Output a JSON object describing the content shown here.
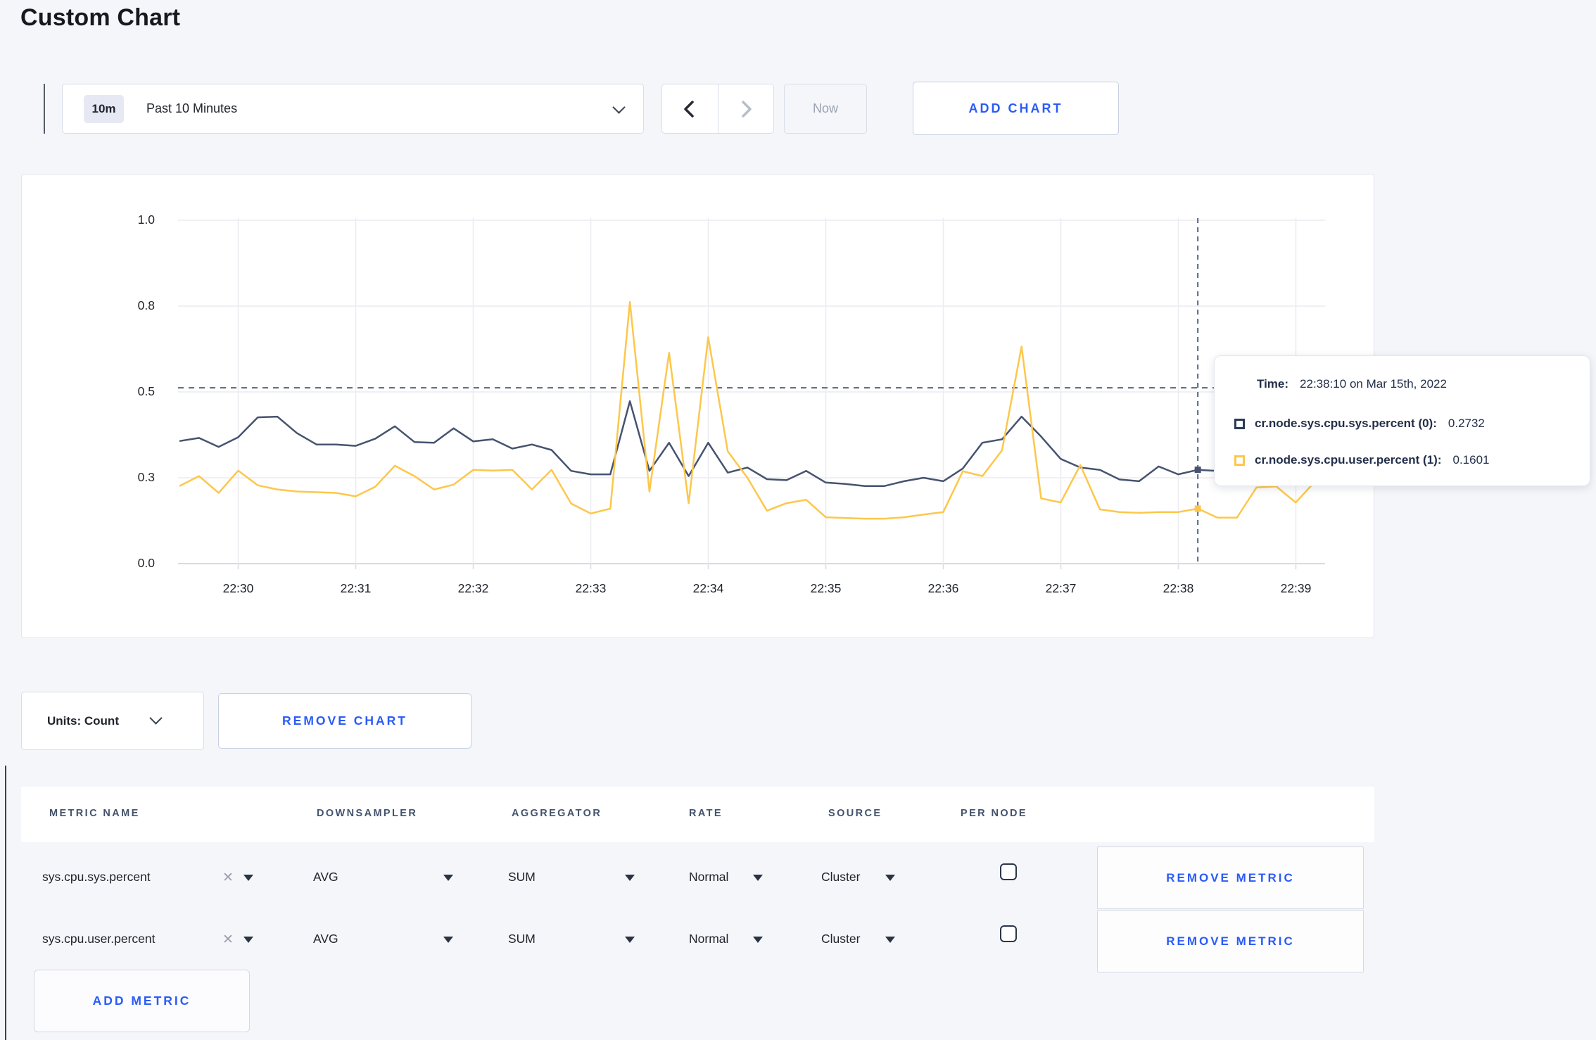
{
  "page": {
    "title": "Custom Chart",
    "accent_color": "#2a5bf7",
    "background": "#f5f6fa"
  },
  "toolbar": {
    "range_badge": "10m",
    "range_label": "Past 10 Minutes",
    "prev_icon": "chevron-left",
    "next_icon": "chevron-right",
    "now_label": "Now",
    "add_chart_label": "ADD CHART"
  },
  "chart_controls": {
    "units_label": "Units: Count",
    "remove_chart_label": "REMOVE CHART"
  },
  "tooltip": {
    "time_label": "Time:",
    "time_value": "22:38:10 on Mar 15th, 2022",
    "entries": [
      {
        "label": "cr.node.sys.cpu.sys.percent (0):",
        "value": "0.2732",
        "color": "#2c3a54"
      },
      {
        "label": "cr.node.sys.cpu.user.percent (1):",
        "value": "0.1601",
        "color": "#fdc74b"
      }
    ]
  },
  "table": {
    "columns": [
      "METRIC NAME",
      "DOWNSAMPLER",
      "AGGREGATOR",
      "RATE",
      "SOURCE",
      "PER NODE"
    ],
    "rows": [
      {
        "metric": "sys.cpu.sys.percent",
        "downsampler": "AVG",
        "aggregator": "SUM",
        "rate": "Normal",
        "source": "Cluster",
        "per_node_checked": false,
        "remove_label": "REMOVE METRIC"
      },
      {
        "metric": "sys.cpu.user.percent",
        "downsampler": "AVG",
        "aggregator": "SUM",
        "rate": "Normal",
        "source": "Cluster",
        "per_node_checked": false,
        "remove_label": "REMOVE METRIC"
      }
    ],
    "add_metric_label": "ADD METRIC"
  },
  "chart_data": {
    "type": "line",
    "x_start": "22:29:30",
    "x_step_seconds": 10,
    "xticks": [
      "22:30",
      "22:31",
      "22:32",
      "22:33",
      "22:34",
      "22:35",
      "22:36",
      "22:37",
      "22:38",
      "22:39"
    ],
    "yticks": {
      "labels": [
        "1.0",
        "0.8",
        "0.5",
        "0.3",
        "0.0"
      ],
      "values": [
        1.0,
        0.75,
        0.5,
        0.25,
        0.0
      ]
    },
    "ylim": [
      0.0,
      1.0
    ],
    "grid": true,
    "series": [
      {
        "name": "cr.node.sys.cpu.sys.percent",
        "color": "#46536f",
        "values": [
          0.357,
          0.366,
          0.34,
          0.368,
          0.426,
          0.428,
          0.38,
          0.347,
          0.347,
          0.343,
          0.364,
          0.4,
          0.354,
          0.352,
          0.394,
          0.356,
          0.362,
          0.335,
          0.347,
          0.331,
          0.27,
          0.26,
          0.26,
          0.473,
          0.27,
          0.352,
          0.255,
          0.352,
          0.265,
          0.28,
          0.246,
          0.243,
          0.27,
          0.236,
          0.232,
          0.226,
          0.226,
          0.24,
          0.25,
          0.24,
          0.277,
          0.352,
          0.362,
          0.428,
          0.37,
          0.305,
          0.28,
          0.273,
          0.245,
          0.24,
          0.283,
          0.26,
          0.2732,
          0.27,
          0.26,
          0.26,
          0.27,
          0.27,
          0.27
        ]
      },
      {
        "name": "cr.node.sys.cpu.user.percent",
        "color": "#fdc74b",
        "values": [
          0.226,
          0.255,
          0.206,
          0.271,
          0.228,
          0.216,
          0.21,
          0.208,
          0.206,
          0.196,
          0.224,
          0.285,
          0.255,
          0.216,
          0.23,
          0.273,
          0.271,
          0.273,
          0.216,
          0.273,
          0.175,
          0.146,
          0.16,
          0.762,
          0.21,
          0.614,
          0.176,
          0.659,
          0.327,
          0.25,
          0.154,
          0.176,
          0.186,
          0.135,
          0.133,
          0.131,
          0.131,
          0.135,
          0.143,
          0.15,
          0.269,
          0.255,
          0.33,
          0.632,
          0.19,
          0.178,
          0.287,
          0.158,
          0.15,
          0.148,
          0.15,
          0.15,
          0.1601,
          0.134,
          0.134,
          0.222,
          0.225,
          0.178,
          0.24
        ]
      }
    ],
    "crosshair": {
      "time": "22:38:10",
      "x_index": 52,
      "hline_value": 0.512,
      "points": [
        {
          "series": 0,
          "value": 0.2732
        },
        {
          "series": 1,
          "value": 0.1601
        }
      ]
    }
  }
}
